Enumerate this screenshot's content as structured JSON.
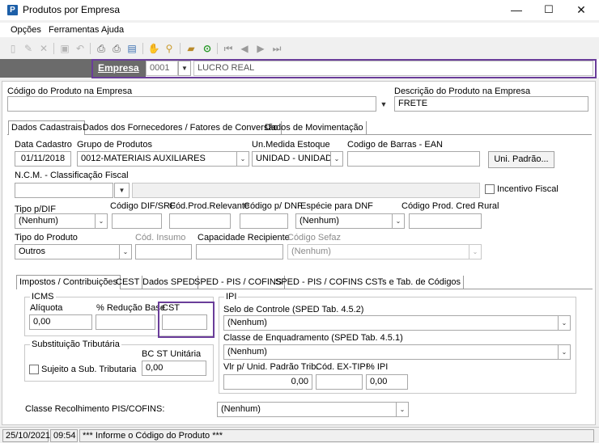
{
  "window": {
    "title": "Produtos por Empresa",
    "minimize": "—",
    "maximize": "☐",
    "close": "✕"
  },
  "menu": {
    "items": [
      "Opções",
      "Ferramentas",
      "Ajuda"
    ]
  },
  "empresa": {
    "label": "Empresa",
    "code": "0001",
    "name": "LUCRO REAL"
  },
  "produto": {
    "codigo_label": "Código do Produto na Empresa",
    "codigo_value": "",
    "descricao_label": "Descrição do Produto na Empresa",
    "descricao_value": "FRETE"
  },
  "tabs_main": [
    "Dados Cadastrais",
    "Dados dos Fornecedores / Fatores de Conversão",
    "Dados de Movimentação"
  ],
  "cadastro": {
    "data_label": "Data Cadastro",
    "data_value": "01/11/2018",
    "grupo_label": "Grupo de Produtos",
    "grupo_value": "0012-MATERIAIS AUXILIARES",
    "unmedida_label": "Un.Medida Estoque",
    "unmedida_value": "UNIDAD - UNIDAD",
    "ean_label": "Codigo de Barras - EAN",
    "ean_value": "",
    "uni_padrao_button": "Uni. Padrão...",
    "ncm_label": "N.C.M. -  Classificação Fiscal",
    "ncm_value": "",
    "incentivo_label": "Incentivo Fiscal",
    "tipo_dif_label": "Tipo p/DIF",
    "tipo_dif_value": "(Nenhum)",
    "cod_dif_label": "Código DIF/SRF",
    "cod_relevante_label": "Cód.Prod.Relevante",
    "cod_dnf_label": "Código p/ DNF",
    "especie_dnf_label": "Espécie para DNF",
    "especie_dnf_value": "(Nenhum)",
    "cred_rural_label": "Código Prod. Cred Rural",
    "tipo_produto_label": "Tipo do Produto",
    "tipo_produto_value": "Outros",
    "cod_insumo_label": "Cód. Insumo",
    "capacidade_label": "Capacidade Recipiente",
    "sefaz_label": "Código Sefaz",
    "sefaz_value": "(Nenhum)"
  },
  "tabs_sub": [
    "Impostos / Contribuições",
    "CEST",
    "Dados SPED",
    "SPED - PIS / COFINS",
    "SPED - PIS / COFINS CSTs e Tab. de Códigos"
  ],
  "icms": {
    "title": "ICMS",
    "aliquota_label": "Alíquota",
    "aliquota_value": "0,00",
    "reducao_label": "% Redução Base",
    "reducao_value": "",
    "cst_label": "CST",
    "cst_value": ""
  },
  "st": {
    "title": "Substituição Tributária",
    "bc_label": "BC ST Unitária",
    "bc_value": "0,00",
    "sujeito_label": "Sujeito a Sub. Tributaria"
  },
  "ipi": {
    "title": "IPI",
    "selo_label": "Selo de Controle (SPED Tab. 4.5.2)",
    "selo_value": "(Nenhum)",
    "classe_label": "Classe de Enquadramento (SPED Tab. 4.5.1)",
    "classe_value": "(Nenhum)",
    "vlr_label": "Vlr p/ Unid. Padrão Trib.",
    "vlr_value": "0,00",
    "extipi_label": "Cód. EX-TIPI",
    "extipi_value": "",
    "pct_label": "% IPI",
    "pct_value": "0,00"
  },
  "pis": {
    "label": "Classe Recolhimento PIS/COFINS:",
    "value": "(Nenhum)"
  },
  "status": {
    "date": "25/10/2021",
    "time": "09:54",
    "message": "*** Informe o Código do Produto ***"
  }
}
